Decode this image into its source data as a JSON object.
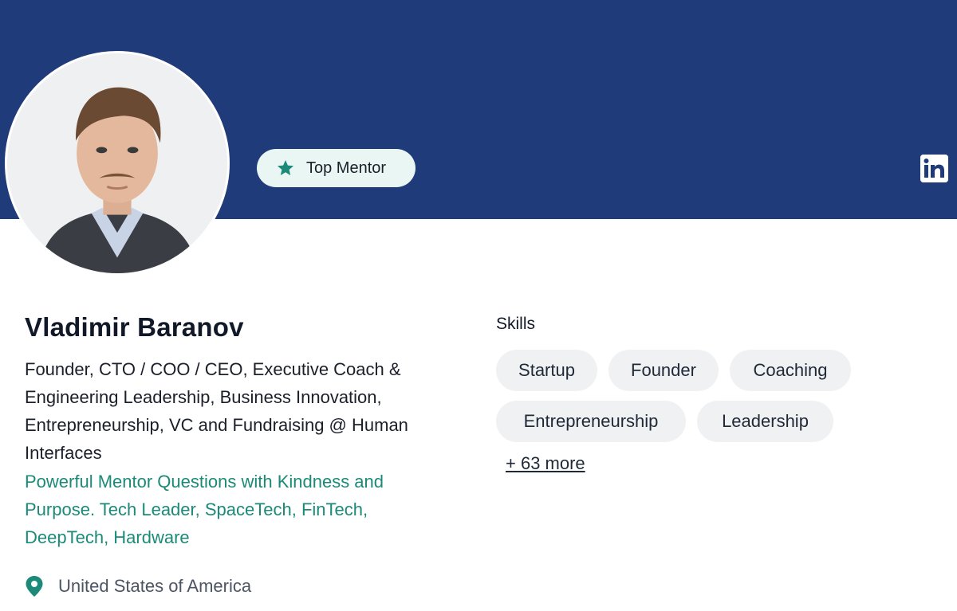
{
  "profile": {
    "badge_label": "Top Mentor",
    "name": "Vladimir Baranov",
    "headline": "Founder, CTO / COO / CEO, Executive Coach & Engineering Leadership, Business Innovation, Entrepreneurship, VC and Fundraising @ Human Interfaces",
    "tagline": "Powerful Mentor Questions with Kindness and Purpose. Tech Leader, SpaceTech, FinTech, DeepTech, Hardware",
    "location": "United States of America"
  },
  "skills": {
    "title": "Skills",
    "items": [
      "Startup",
      "Founder",
      "Coaching",
      "Entrepreneurship",
      "Leadership"
    ],
    "more_label": "+ 63 more"
  },
  "icons": {
    "badge": "star-icon",
    "social": "linkedin-icon",
    "location": "map-pin-icon"
  },
  "colors": {
    "banner": "#1f3b7a",
    "accent": "#1b8a78",
    "badge_bg": "#e9f6f3",
    "chip_bg": "#f0f1f3"
  }
}
